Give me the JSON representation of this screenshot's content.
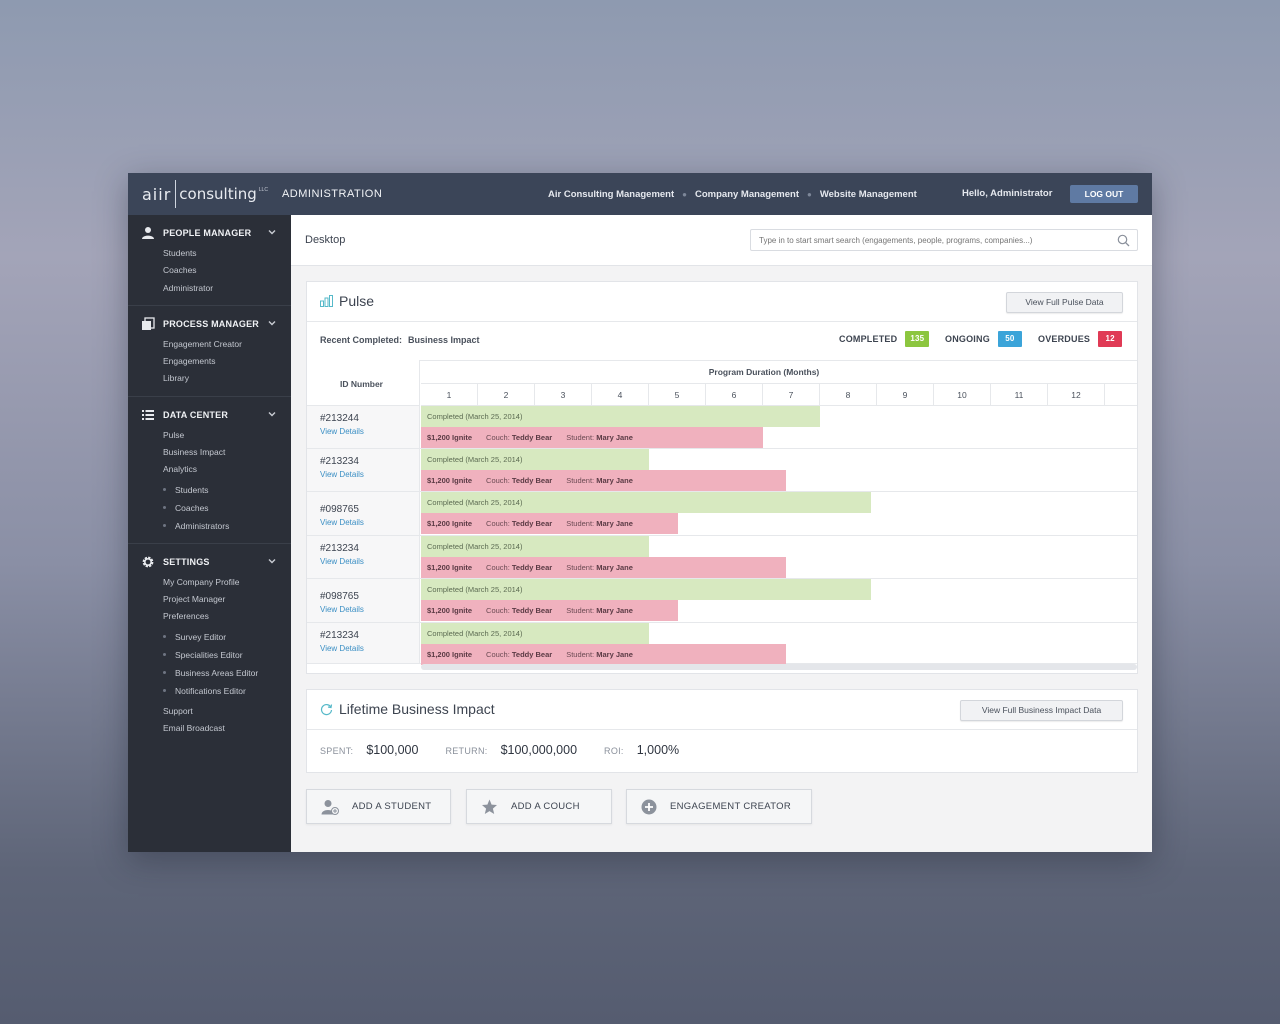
{
  "brand": {
    "logo_left": "aiir",
    "logo_right": "consulting",
    "logo_suffix": "LLC",
    "section": "ADMINISTRATION"
  },
  "topnav": {
    "links": [
      "Air Consulting Management",
      "Company Management",
      "Website Management"
    ],
    "greeting": "Hello, Administrator",
    "logout": "LOG OUT"
  },
  "sidebar": {
    "people_manager": {
      "title": "PEOPLE MANAGER",
      "items": [
        "Students",
        "Coaches",
        "Administrator"
      ]
    },
    "process_manager": {
      "title": "PROCESS MANAGER",
      "items": [
        "Engagement Creator",
        "Engagements",
        "Library"
      ]
    },
    "data_center": {
      "title": "DATA CENTER",
      "items": [
        "Pulse",
        "Business Impact",
        "Analytics"
      ],
      "subitems": [
        "Students",
        "Coaches",
        "Administrators"
      ]
    },
    "settings": {
      "title": "SETTINGS",
      "items": [
        "My Company Profile",
        "Project Manager",
        "Preferences"
      ],
      "subitems": [
        "Survey Editor",
        "Specialities Editor",
        "Business Areas Editor",
        "Notifications Editor"
      ],
      "footer_items": [
        "Support",
        "Email Broadcast"
      ]
    }
  },
  "header": {
    "title": "Desktop",
    "search_placeholder": "Type in to start smart search (engagements, people, programs, companies...)"
  },
  "pulse": {
    "title": "Pulse",
    "view_button": "View Full Pulse Data",
    "recent_label": "Recent Completed:",
    "recent_value": "Business Impact",
    "stats": {
      "completed_label": "COMPLETED",
      "completed_value": "135",
      "ongoing_label": "ONGOING",
      "ongoing_value": "50",
      "overdues_label": "OVERDUES",
      "overdues_value": "12"
    },
    "colors": {
      "completed": "#8cc63f",
      "ongoing": "#3ba4d9",
      "overdue": "#e03a55",
      "bar_green": "#d7e9c0",
      "bar_red": "#f0b1be"
    },
    "table": {
      "id_header": "ID Number",
      "duration_header": "Program Duration (Months)",
      "months": [
        "1",
        "2",
        "3",
        "4",
        "5",
        "6",
        "7",
        "8",
        "9",
        "10",
        "11",
        "12"
      ],
      "rows": [
        {
          "id": "#213244",
          "link": "View Details",
          "status": "Completed (March 25, 2014)",
          "completed_months": 7,
          "amount": "$1,200 Ignite",
          "couch_label": "Couch:",
          "couch": "Teddy Bear",
          "student_label": "Student:",
          "student": "Mary Jane",
          "ongoing_months": 6
        },
        {
          "id": "#213234",
          "link": "View Details",
          "status": "Completed (March 25, 2014)",
          "completed_months": 4,
          "amount": "$1,200 Ignite",
          "couch_label": "Couch:",
          "couch": "Teddy Bear",
          "student_label": "Student:",
          "student": "Mary Jane",
          "ongoing_months": 6.4
        },
        {
          "id": "#098765",
          "link": "View Details",
          "status": "Completed (March 25, 2014)",
          "completed_months": 7.9,
          "amount": "$1,200 Ignite",
          "couch_label": "Couch:",
          "couch": "Teddy Bear",
          "student_label": "Student:",
          "student": "Mary Jane",
          "ongoing_months": 4.5
        },
        {
          "id": "#213234",
          "link": "View Details",
          "status": "Completed (March 25, 2014)",
          "completed_months": 4,
          "amount": "$1,200 Ignite",
          "couch_label": "Couch:",
          "couch": "Teddy Bear",
          "student_label": "Student:",
          "student": "Mary Jane",
          "ongoing_months": 6.4
        },
        {
          "id": "#098765",
          "link": "View Details",
          "status": "Completed (March 25, 2014)",
          "completed_months": 7.9,
          "amount": "$1,200 Ignite",
          "couch_label": "Couch:",
          "couch": "Teddy Bear",
          "student_label": "Student:",
          "student": "Mary Jane",
          "ongoing_months": 4.5
        },
        {
          "id": "#213234",
          "link": "View Details",
          "status": "Completed (March 25, 2014)",
          "completed_months": 4,
          "amount": "$1,200 Ignite",
          "couch_label": "Couch:",
          "couch": "Teddy Bear",
          "student_label": "Student:",
          "student": "Mary Jane",
          "ongoing_months": 6.4
        }
      ]
    }
  },
  "impact": {
    "title": "Lifetime Business Impact",
    "view_button": "View Full Business Impact Data",
    "spent_label": "SPENT:",
    "spent_value": "$100,000",
    "return_label": "RETURN:",
    "return_value": "$100,000,000",
    "roi_label": "ROI:",
    "roi_value": "1,000%"
  },
  "actions": {
    "add_student": "ADD A STUDENT",
    "add_couch": "ADD A COUCH",
    "engagement_creator": "ENGAGEMENT CREATOR"
  },
  "icons": [
    "user-icon",
    "copy-icon",
    "list-icon",
    "gear-icon",
    "chevron-down-icon",
    "search-icon",
    "bar-chart-icon",
    "refresh-icon",
    "add-user-icon",
    "star-icon",
    "plus-circle-icon"
  ]
}
